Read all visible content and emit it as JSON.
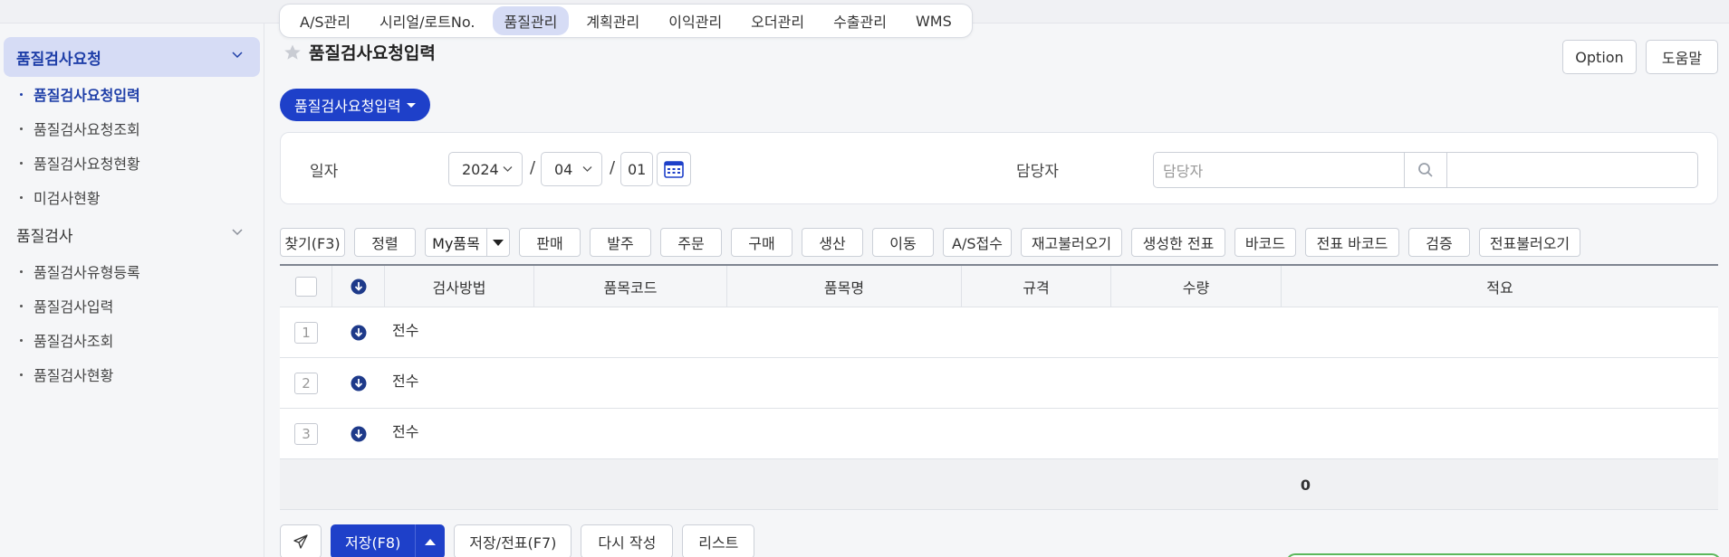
{
  "menu_tabs": [
    "A/S관리",
    "시리얼/로트No.",
    "품질관리",
    "계획관리",
    "이익관리",
    "오더관리",
    "수출관리",
    "WMS"
  ],
  "menu_active": "품질관리",
  "sidebar": {
    "groups": [
      {
        "label": "품질검사요청",
        "items": [
          "품질검사요청입력",
          "품질검사요청조회",
          "품질검사요청현황",
          "미검사현황"
        ]
      },
      {
        "label": "품질검사",
        "items": [
          "품질검사유형등록",
          "품질검사입력",
          "품질검사조회",
          "품질검사현황"
        ]
      }
    ]
  },
  "page": {
    "title": "품질검사요청입력",
    "option_label": "Option",
    "help_label": "도움말",
    "form_tab": "품질검사요청입력"
  },
  "form": {
    "date_label": "일자",
    "year": "2024",
    "month": "04",
    "day": "01",
    "sep": "/",
    "manager_label": "담당자",
    "manager_placeholder": "담당자"
  },
  "toolbar": [
    "찾기(F3)",
    "정렬",
    "My품목",
    "판매",
    "발주",
    "주문",
    "구매",
    "생산",
    "이동",
    "A/S접수",
    "재고불러오기",
    "생성한 전표",
    "바코드",
    "전표 바코드",
    "검증",
    "전표불러오기"
  ],
  "grid": {
    "columns": [
      "검사방법",
      "품목코드",
      "품목명",
      "규격",
      "수량",
      "적요"
    ],
    "rows": [
      {
        "num": "1",
        "method": "전수"
      },
      {
        "num": "2",
        "method": "전수"
      },
      {
        "num": "3",
        "method": "전수"
      }
    ],
    "total_qty": "0"
  },
  "bottom": {
    "save": "저장(F8)",
    "save_slip": "저장/전표(F7)",
    "rewrite": "다시 작성",
    "list": "리스트"
  },
  "colors": {
    "accent": "#1e40c9",
    "active_bg": "#d6dcf5"
  }
}
